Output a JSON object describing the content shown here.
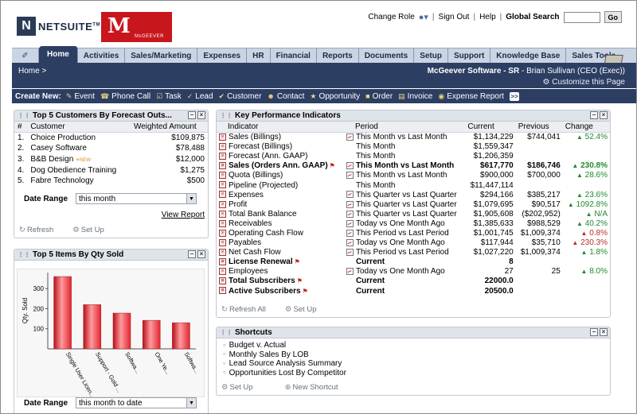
{
  "header": {
    "logo_mark": "N",
    "logo_text": "NETSUITE",
    "logo_tm": "TM",
    "company_logo_mark": "M",
    "company_logo_name": "McGEEVER",
    "change_role": "Change Role",
    "sign_out": "Sign Out",
    "help": "Help",
    "global_search": "Global Search",
    "go": "Go",
    "sep": "|"
  },
  "nav": {
    "items": [
      "Home",
      "Activities",
      "Sales/Marketing",
      "Expenses",
      "HR",
      "Financial",
      "Reports",
      "Documents",
      "Setup",
      "Support",
      "Knowledge Base",
      "Sales Tools"
    ]
  },
  "subbar": {
    "breadcrumb": "Home >",
    "company": "McGeever Software - SR",
    "user": " - Brian Sullivan (CEO (Exec))",
    "customize": "Customize this Page"
  },
  "create_new": {
    "label": "Create New:",
    "items": [
      "Event",
      "Phone Call",
      "Task",
      "Lead",
      "Customer",
      "Contact",
      "Opportunity",
      "Order",
      "Invoice",
      "Expense Report"
    ],
    "more": ">>"
  },
  "customers_portlet": {
    "title": "Top 5 Customers By Forecast Outs...",
    "col_num": "#",
    "col_customer": "Customer",
    "col_amount": "Weighted Amount",
    "rows": [
      {
        "n": "1.",
        "name": "Choice Production",
        "amount": "$109,875"
      },
      {
        "n": "2.",
        "name": "Casey Software",
        "amount": "$78,488"
      },
      {
        "n": "3.",
        "name": "B&B Design",
        "amount": "$12,000"
      },
      {
        "n": "4.",
        "name": "Dog Obedience Training",
        "amount": "$1,275"
      },
      {
        "n": "5.",
        "name": "Fabre Technology",
        "amount": "$500"
      }
    ],
    "new_tag": "NEW",
    "date_range_label": "Date Range",
    "date_range_value": "this month",
    "view_report": "View Report",
    "refresh": "Refresh",
    "set_up": "Set Up"
  },
  "items_portlet": {
    "title": "Top 5 Items By Qty Sold",
    "date_range_label": "Date Range",
    "date_range_value": "this month to date"
  },
  "chart_data": {
    "type": "bar",
    "categories": [
      "Single User Licen...",
      "Support - Gold ...",
      "Softwa...",
      "One Ye...",
      "Softwa..."
    ],
    "values": [
      360,
      220,
      178,
      142,
      130
    ],
    "ylabel": "Qty. Sold",
    "ylim": [
      0,
      380
    ],
    "yticks": [
      100,
      200,
      300
    ],
    "bar_color": "#e0262f"
  },
  "kpi_portlet": {
    "title": "Key Performance Indicators",
    "columns": [
      "Indicator",
      "Period",
      "Current",
      "Previous",
      "Change"
    ],
    "rows": [
      {
        "indicator": "Sales (Billings)",
        "period": "This Month vs Last Month",
        "current": "$1,134,229",
        "previous": "$744,041",
        "change": "52.4%",
        "dir": "up",
        "graph": true,
        "bold": false,
        "flag": false
      },
      {
        "indicator": "Forecast (Billings)",
        "period": "This Month",
        "current": "$1,559,347",
        "previous": "",
        "change": "",
        "dir": "",
        "graph": false,
        "bold": false,
        "flag": false
      },
      {
        "indicator": "Forecast (Ann. GAAP)",
        "period": "This Month",
        "current": "$1,206,359",
        "previous": "",
        "change": "",
        "dir": "",
        "graph": false,
        "bold": false,
        "flag": false
      },
      {
        "indicator": "Sales (Orders Ann. GAAP)",
        "period": "This Month vs Last Month",
        "current": "$617,770",
        "previous": "$186,746",
        "change": "230.8%",
        "dir": "up",
        "graph": true,
        "bold": true,
        "flag": true
      },
      {
        "indicator": "Quota (Billings)",
        "period": "This Month vs Last Month",
        "current": "$900,000",
        "previous": "$700,000",
        "change": "28.6%",
        "dir": "up",
        "graph": true,
        "bold": false,
        "flag": false
      },
      {
        "indicator": "Pipeline (Projected)",
        "period": "This Month",
        "current": "$11,447,114",
        "previous": "",
        "change": "",
        "dir": "",
        "graph": false,
        "bold": false,
        "flag": false
      },
      {
        "indicator": "Expenses",
        "period": "This Quarter vs Last Quarter",
        "current": "$294,166",
        "previous": "$385,217",
        "change": "23.6%",
        "dir": "up",
        "graph": true,
        "bold": false,
        "flag": false
      },
      {
        "indicator": "Profit",
        "period": "This Quarter vs Last Quarter",
        "current": "$1,079,695",
        "previous": "$90,517",
        "change": "1092.8%",
        "dir": "up",
        "graph": true,
        "bold": false,
        "flag": false
      },
      {
        "indicator": "Total Bank Balance",
        "period": "This Quarter vs Last Quarter",
        "current": "$1,905,608",
        "previous": "($202,952)",
        "change": "N/A",
        "dir": "up",
        "graph": true,
        "bold": false,
        "flag": false
      },
      {
        "indicator": "Receivables",
        "period": "Today vs One Month Ago",
        "current": "$1,385,633",
        "previous": "$988,529",
        "change": "40.2%",
        "dir": "up",
        "graph": true,
        "bold": false,
        "flag": false
      },
      {
        "indicator": "Operating Cash Flow",
        "period": "This Period vs Last Period",
        "current": "$1,001,745",
        "previous": "$1,009,374",
        "change": "0.8%",
        "dir": "down",
        "graph": true,
        "bold": false,
        "flag": false
      },
      {
        "indicator": "Payables",
        "period": "Today vs One Month Ago",
        "current": "$117,944",
        "previous": "$35,710",
        "change": "230.3%",
        "dir": "down",
        "graph": true,
        "bold": false,
        "flag": false
      },
      {
        "indicator": "Net Cash Flow",
        "period": "This Period vs Last Period",
        "current": "$1,027,220",
        "previous": "$1,009,374",
        "change": "1.8%",
        "dir": "up",
        "graph": true,
        "bold": false,
        "flag": false
      },
      {
        "indicator": "License Renewal",
        "period": "Current",
        "current": "8",
        "previous": "",
        "change": "",
        "dir": "",
        "graph": false,
        "bold": true,
        "flag": true
      },
      {
        "indicator": "Employees",
        "period": "Today vs One Month Ago",
        "current": "27",
        "previous": "25",
        "change": "8.0%",
        "dir": "up",
        "graph": true,
        "bold": false,
        "flag": false
      },
      {
        "indicator": "Total Subscribers",
        "period": "Current",
        "current": "22000.0",
        "previous": "",
        "change": "",
        "dir": "",
        "graph": false,
        "bold": true,
        "flag": true
      },
      {
        "indicator": "Active Subscribers",
        "period": "Current",
        "current": "20500.0",
        "previous": "",
        "change": "",
        "dir": "",
        "graph": false,
        "bold": true,
        "flag": true
      }
    ],
    "refresh_all": "Refresh All",
    "set_up": "Set Up"
  },
  "shortcuts_portlet": {
    "title": "Shortcuts",
    "items": [
      "Budget v. Actual",
      "Monthly Sales By LOB",
      "Lead Source Analysis Summary",
      "Opportunities Lost By Competitor"
    ],
    "set_up": "Set Up",
    "new_shortcut": "New Shortcut"
  },
  "colors": {
    "nav_dark": "#2d3e63",
    "up": "#1f8a2d",
    "down": "#c22a2a",
    "brand_red": "#c8161d"
  }
}
